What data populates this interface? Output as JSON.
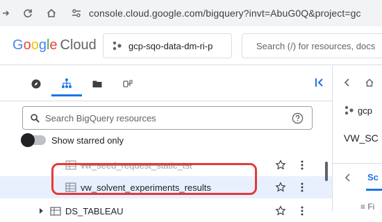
{
  "browser": {
    "url": "console.cloud.google.com/bigquery?invt=AbuG0Q&project=gc"
  },
  "header": {
    "logo_google": [
      "G",
      "o",
      "o",
      "g",
      "l",
      "e"
    ],
    "logo_cloud": "Cloud",
    "project_name": "gcp-sqo-data-dm-ri-p",
    "search_placeholder": "Search (/) for resources, docs"
  },
  "explorer": {
    "tabs": [
      "compass-icon",
      "explorer-tree-icon",
      "folder-icon",
      "pipelines-icon"
    ],
    "search_placeholder": "Search BigQuery resources",
    "starred_label": "Show starred only",
    "rows": [
      {
        "label": "vw_seed_request_static_tst",
        "icon": "table-icon"
      },
      {
        "label": "vw_solvent_experiments_results",
        "icon": "table-icon",
        "selected": true
      },
      {
        "label": "DS_TABLEAU",
        "icon": "dataset-icon"
      }
    ]
  },
  "details": {
    "project_short": "gcp",
    "title_short": "VW_SC",
    "tab_short": "Sc",
    "filter_short": "Fi"
  },
  "colors": {
    "accent": "#1a73e8",
    "highlight": "#e53935",
    "selected_row": "#e8f0fe"
  }
}
